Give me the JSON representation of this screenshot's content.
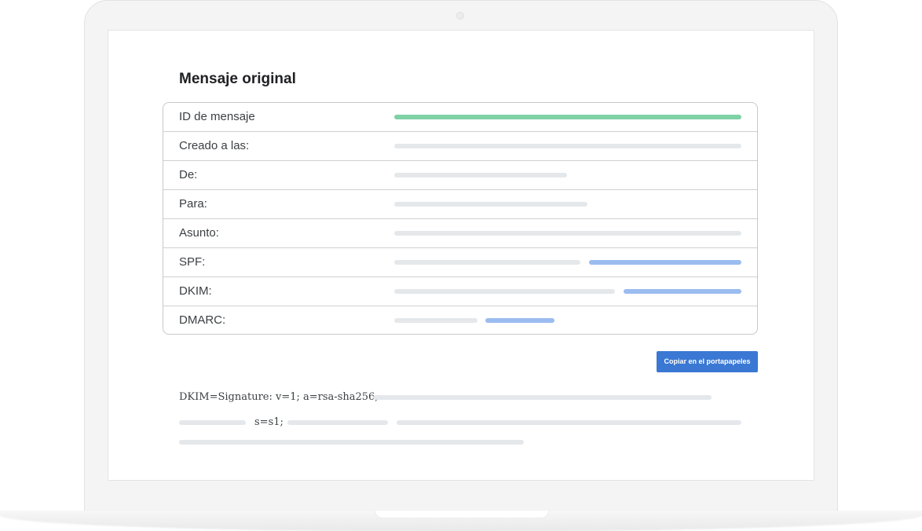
{
  "section": {
    "title": "Mensaje original"
  },
  "headers_table": {
    "rows": [
      {
        "label": "ID de mensaje"
      },
      {
        "label": "Creado a las:"
      },
      {
        "label": "De:"
      },
      {
        "label": "Para:"
      },
      {
        "label": "Asunto:"
      },
      {
        "label": "SPF:"
      },
      {
        "label": "DKIM:"
      },
      {
        "label": "DMARC:"
      }
    ]
  },
  "actions": {
    "copy_label": "Copiar en el portapapeles"
  },
  "raw_header": {
    "line1": "DKIM=Signature: v=1; a=rsa-sha256;",
    "line2_fragment": "s=s1;"
  },
  "colors": {
    "accent_button": "#3a78d4",
    "highlight_green": "#7fd1a6",
    "highlight_blue": "#9bbcf0",
    "placeholder_gray": "#e5e8eb"
  }
}
